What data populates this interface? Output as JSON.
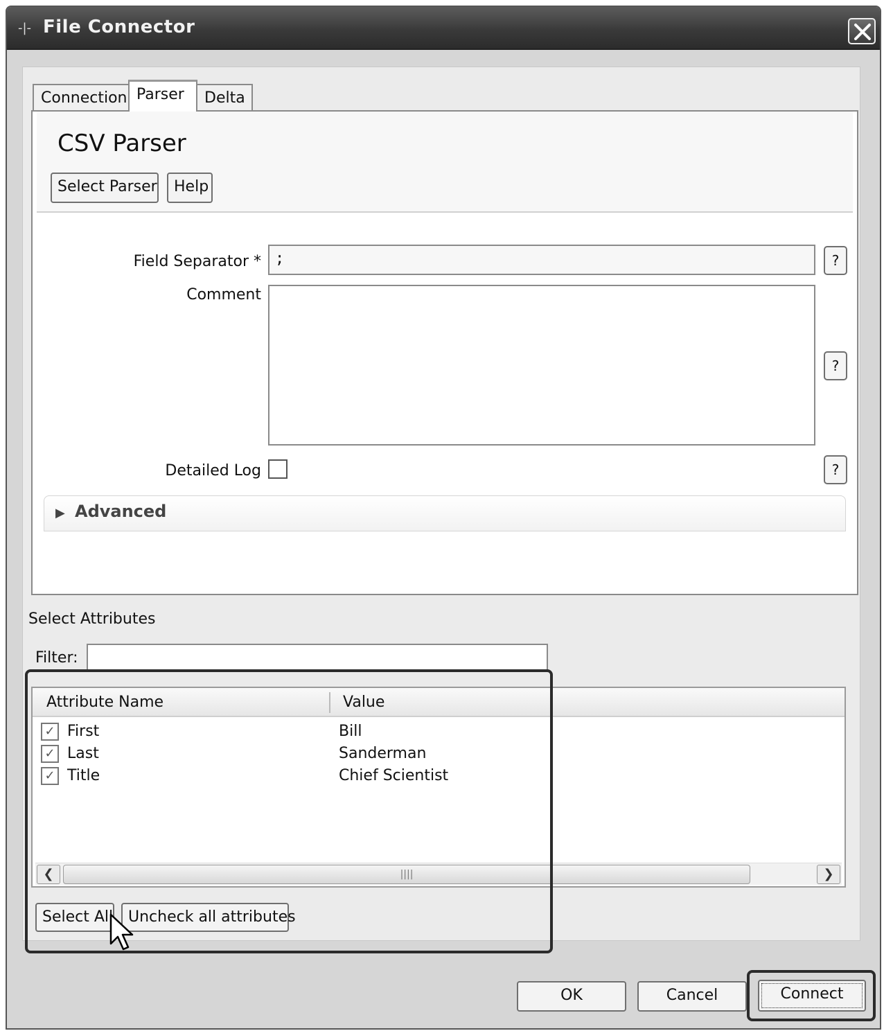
{
  "window": {
    "title": "File Connector"
  },
  "tabs": [
    {
      "label": "Connection",
      "active": false
    },
    {
      "label": "Parser",
      "active": true
    },
    {
      "label": "Delta",
      "active": false
    }
  ],
  "parser": {
    "title": "CSV Parser",
    "select_parser_label": "Select Parser",
    "help_label": "Help"
  },
  "form": {
    "field_separator_label": "Field Separator *",
    "field_separator_value": ";",
    "comment_label": "Comment",
    "comment_value": "",
    "detailed_log_label": "Detailed Log",
    "detailed_log_checked": false,
    "help_glyph": "?"
  },
  "advanced": {
    "label": "Advanced",
    "expanded": false
  },
  "attributes": {
    "section_label": "Select Attributes",
    "filter_label": "Filter:",
    "filter_value": "",
    "columns": [
      "Attribute Name",
      "Value"
    ],
    "rows": [
      {
        "name": "First",
        "value": "Bill",
        "checked": true
      },
      {
        "name": "Last",
        "value": "Sanderman",
        "checked": true
      },
      {
        "name": "Title",
        "value": "Chief Scientist",
        "checked": true
      }
    ],
    "select_all_label": "Select All",
    "uncheck_all_label": "Uncheck all attributes"
  },
  "footer": {
    "ok_label": "OK",
    "cancel_label": "Cancel",
    "connect_label": "Connect"
  }
}
